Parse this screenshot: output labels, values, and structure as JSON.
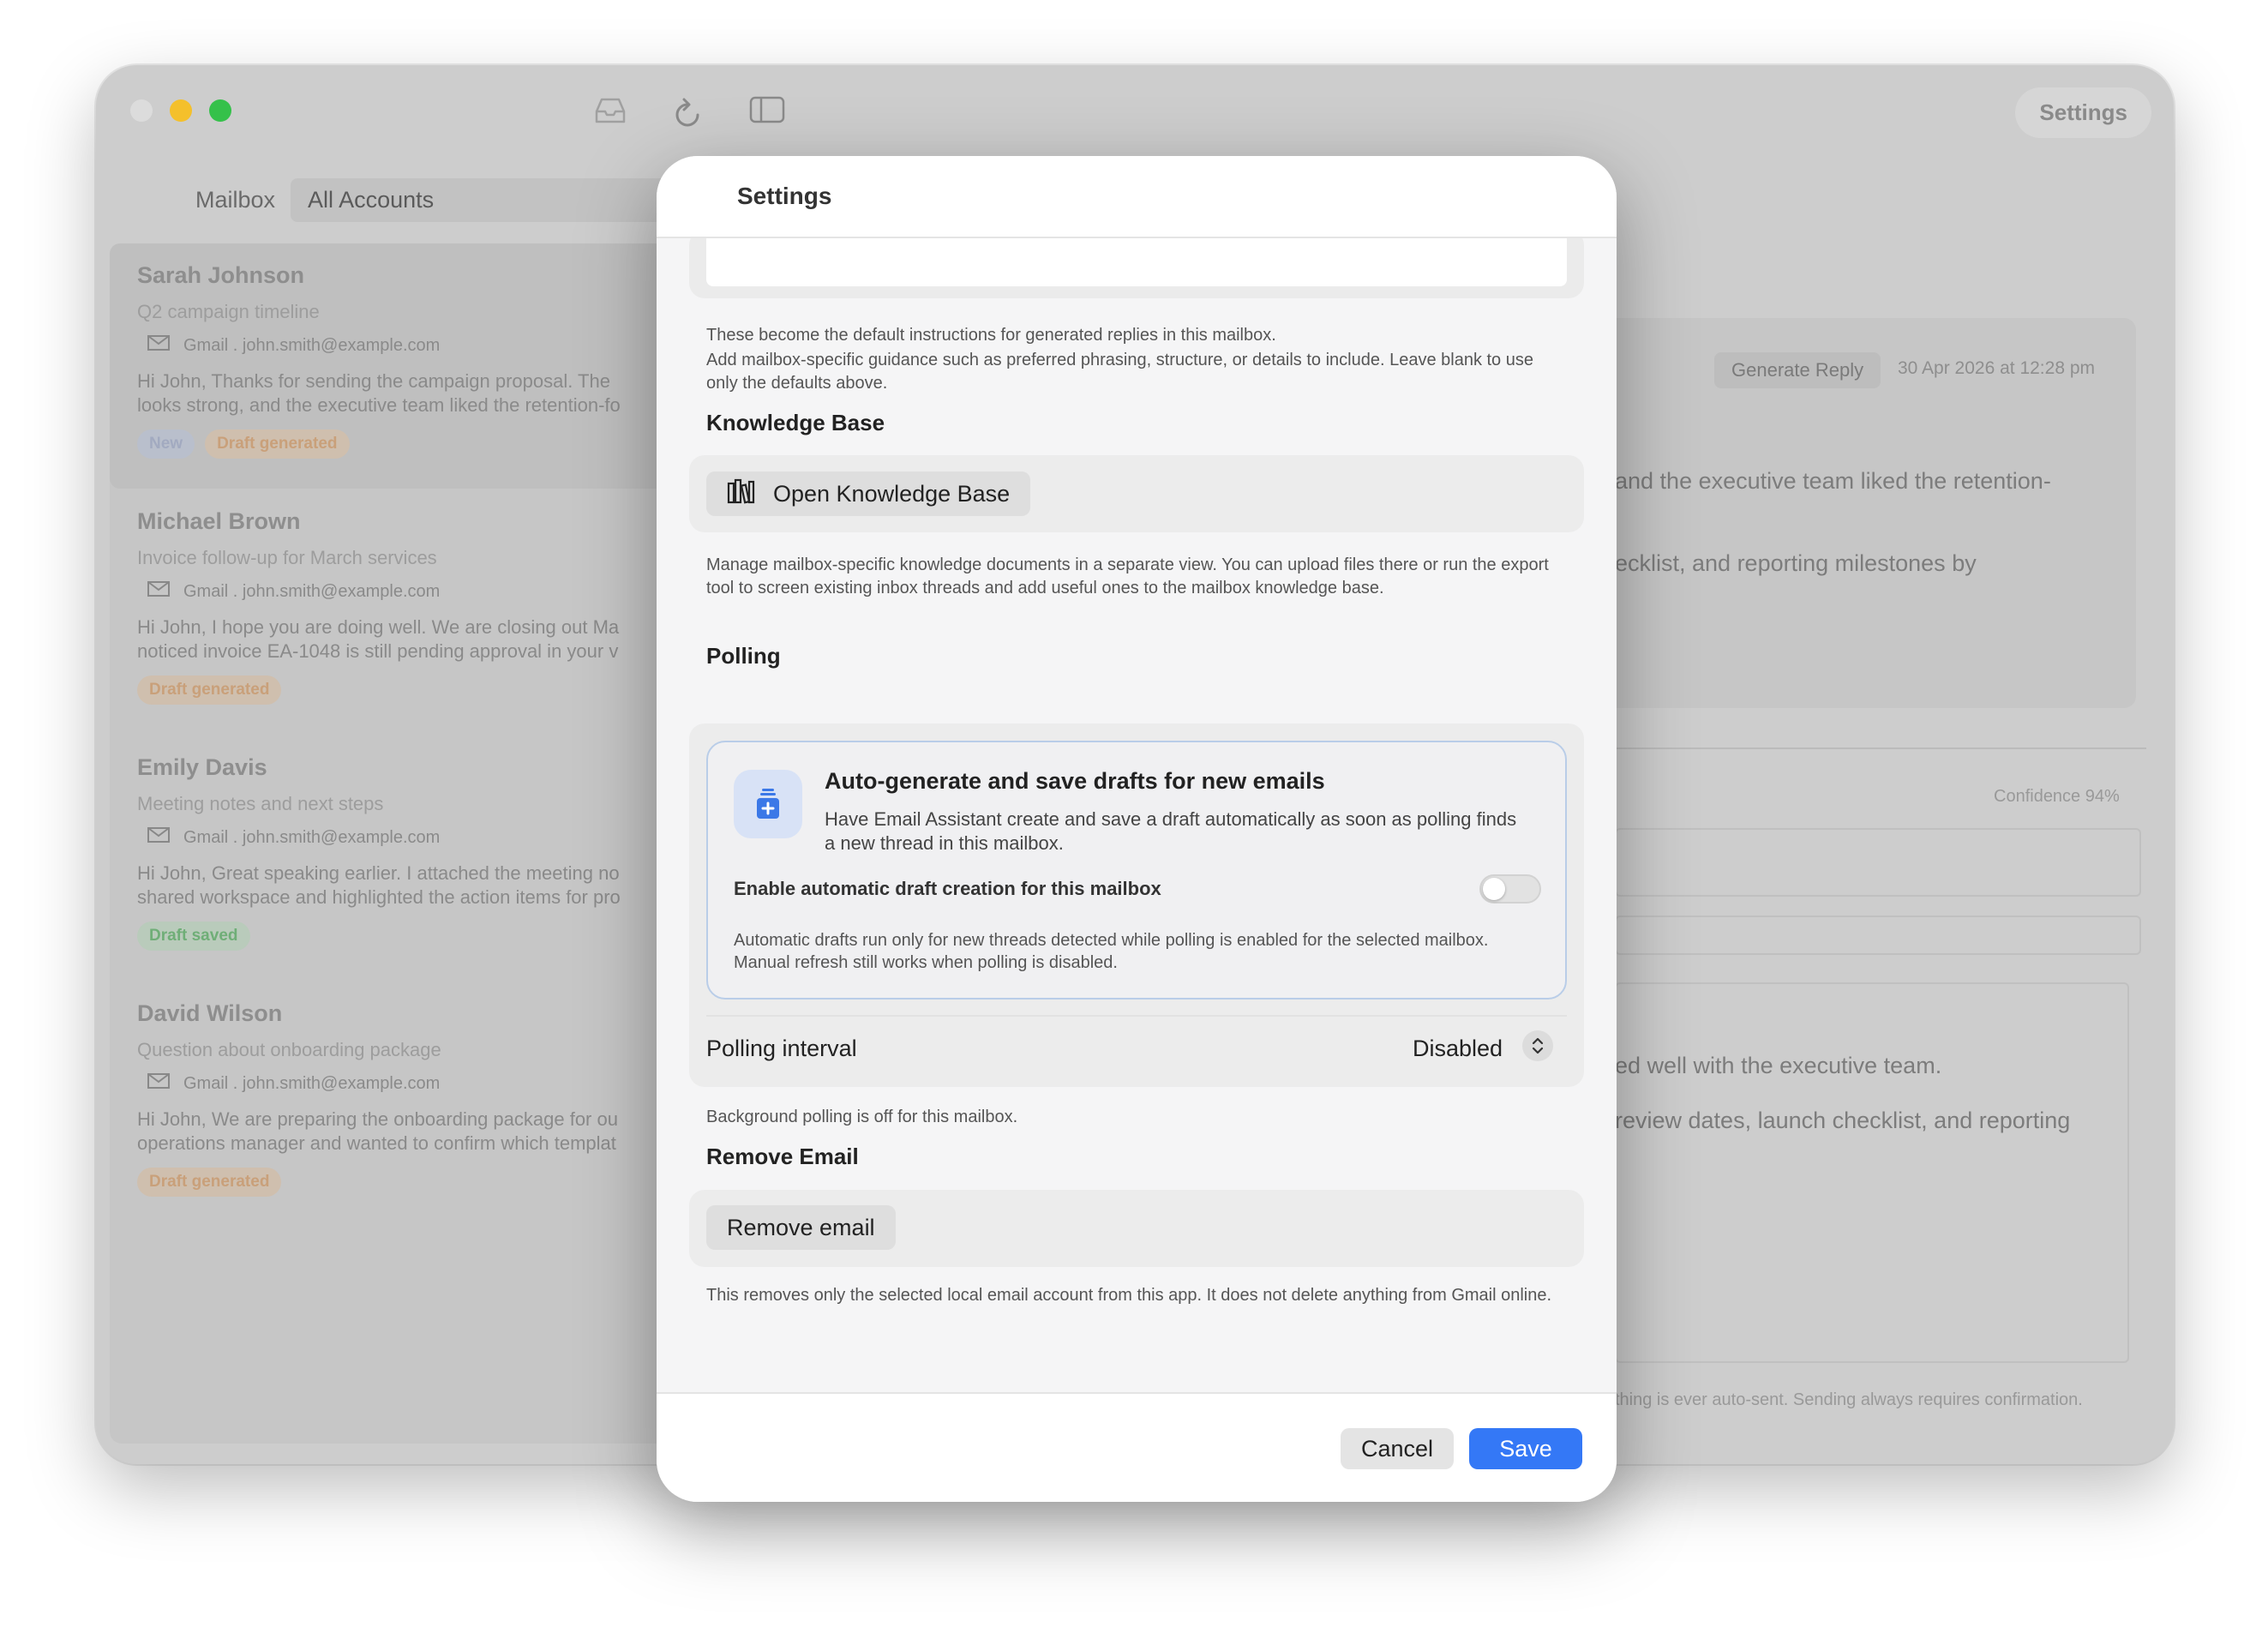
{
  "window": {
    "toolbar_icons": [
      "inbox-icon",
      "refresh-icon",
      "sidebar-icon"
    ],
    "settings_label": "Settings"
  },
  "mailbox": {
    "label": "Mailbox",
    "selected": "All Accounts"
  },
  "emails": [
    {
      "name": "Sarah Johnson",
      "subject": "Q2 campaign timeline",
      "account": "Gmail . john.smith@example.com",
      "preview_1": "Hi John,  Thanks for sending the campaign proposal. The",
      "preview_2": "looks strong, and the executive team liked the retention-fo",
      "badges": [
        {
          "text": "New",
          "type": "new"
        },
        {
          "text": "Draft generated",
          "type": "draft"
        }
      ]
    },
    {
      "name": "Michael Brown",
      "subject": "Invoice follow-up for March services",
      "account": "Gmail . john.smith@example.com",
      "preview_1": "Hi John,  I hope you are doing well. We are closing out Ma",
      "preview_2": "noticed invoice EA-1048 is still pending approval in your v",
      "badges": [
        {
          "text": "Draft generated",
          "type": "draft"
        }
      ]
    },
    {
      "name": "Emily Davis",
      "subject": "Meeting notes and next steps",
      "account": "Gmail . john.smith@example.com",
      "preview_1": "Hi John,  Great speaking earlier. I attached the meeting no",
      "preview_2": "shared workspace and highlighted the action items for pro",
      "badges": [
        {
          "text": "Draft saved",
          "type": "saved"
        }
      ]
    },
    {
      "name": "David Wilson",
      "subject": "Question about onboarding package",
      "account": "Gmail . john.smith@example.com",
      "preview_1": "Hi John,  We are preparing the onboarding package for ou",
      "preview_2": "operations manager and wanted to confirm which templat",
      "badges": [
        {
          "text": "Draft generated",
          "type": "draft"
        }
      ]
    }
  ],
  "reading_pane": {
    "generate_reply": "Generate Reply",
    "date": "30 Apr 2026 at 12:28 pm",
    "body_1": "and the executive team liked the retention-",
    "body_2": "ecklist, and reporting milestones by",
    "confidence": "Confidence 94%",
    "draft_1": "ed well with the executive team.",
    "draft_2": "review dates, launch checklist, and reporting",
    "footer": "thing is ever auto-sent. Sending always requires confirmation."
  },
  "settings": {
    "title": "Settings",
    "instructions_help_1": "These become the default instructions for generated replies in this mailbox.",
    "instructions_help_2": "Add mailbox-specific guidance such as preferred phrasing, structure, or details to include. Leave blank to use only the defaults above.",
    "kb_heading": "Knowledge Base",
    "kb_button": "Open Knowledge Base",
    "kb_help": "Manage mailbox-specific knowledge documents in a separate view. You can upload files there or run the export tool to screen existing inbox threads and add useful ones to the mailbox knowledge base.",
    "polling_heading": "Polling",
    "auto_title": "Auto-generate and save drafts for new emails",
    "auto_desc": "Have Email Assistant create and save a draft automatically as soon as polling finds a new thread in this mailbox.",
    "auto_toggle_label": "Enable automatic draft creation for this mailbox",
    "auto_toggle_on": false,
    "auto_note": "Automatic drafts run only for new threads detected while polling is enabled for the selected mailbox. Manual refresh still works when polling is disabled.",
    "polling_interval_label": "Polling interval",
    "polling_interval_value": "Disabled",
    "polling_help": "Background polling is off for this mailbox.",
    "remove_heading": "Remove Email",
    "remove_button": "Remove email",
    "remove_help": "This removes only the selected local email account from this app. It does not delete anything from Gmail online.",
    "cancel": "Cancel",
    "save": "Save"
  },
  "colors": {
    "accent": "#3478f6",
    "auto_border": "#b9cde8",
    "icon_bg": "#d8e2f6"
  }
}
